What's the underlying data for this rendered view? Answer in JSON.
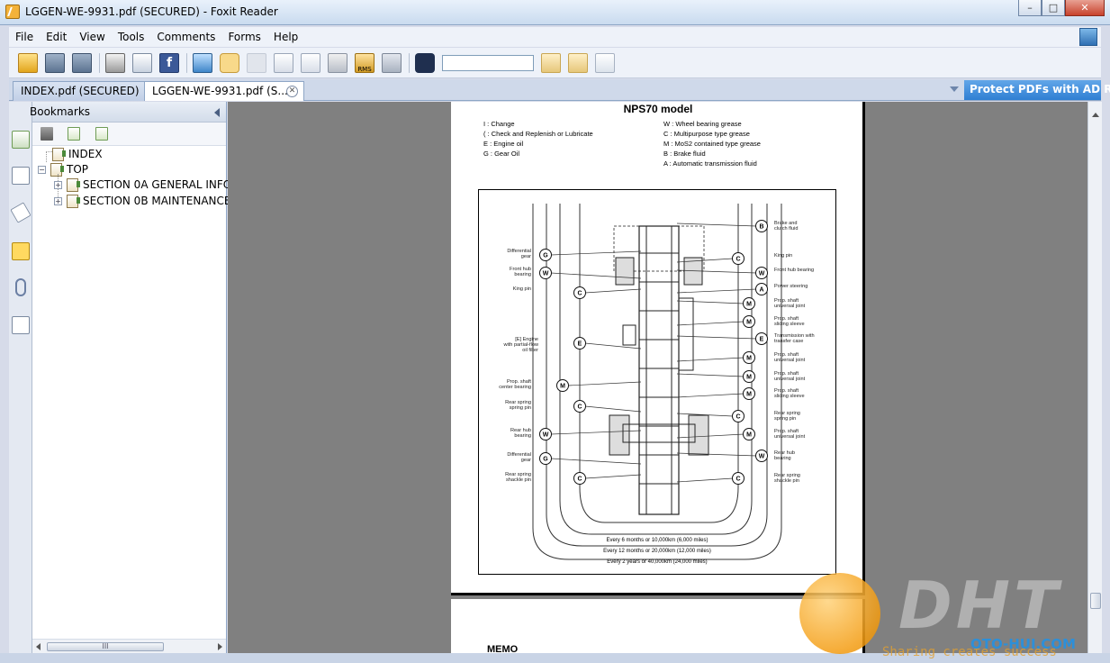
{
  "window": {
    "title": "LGGEN-WE-9931.pdf (SECURED) - Foxit Reader",
    "buttons": {
      "min": "–",
      "max": "□",
      "close": "✕"
    }
  },
  "menu": [
    "File",
    "Edit",
    "View",
    "Tools",
    "Comments",
    "Forms",
    "Help"
  ],
  "toolbar": {
    "icons": [
      "open-icon",
      "save-icon",
      "save-all-icon",
      "print-icon",
      "email-icon",
      "facebook-icon",
      "fullscreen-icon",
      "hand-tool-icon",
      "zoom-tool-icon",
      "select-tool-icon",
      "text-select-icon",
      "snapshot-icon",
      "rms-icon",
      "sign-icon",
      "find-icon",
      "find-prev-icon",
      "find-next-icon",
      "clear-search-icon"
    ],
    "facebook_label": "f",
    "rms_label": "RMS",
    "search_value": ""
  },
  "tabs": [
    {
      "label": "INDEX.pdf (SECURED)"
    },
    {
      "label": "LGGEN-WE-9931.pdf (S..."
    }
  ],
  "protect_label": "Protect PDFs with AD RMS",
  "bookmarks": {
    "header": "Bookmarks",
    "items": [
      {
        "label": "INDEX"
      },
      {
        "label": "TOP"
      },
      {
        "label": "SECTION 0A GENERAL INFOR"
      },
      {
        "label": "SECTION 0B MAINTENANCE A"
      }
    ],
    "scroll_label": "III"
  },
  "document": {
    "title": "NPS70 model",
    "legend_left": [
      "I : Change",
      "( : Check and Replenish or Lubricate",
      "E : Engine oil",
      "G : Gear Oil"
    ],
    "legend_right": [
      "W : Wheel bearing grease",
      "C : Multipurpose type grease",
      "M : MoS2 contained type grease",
      "B : Brake fluid",
      "A : Automatic transmission fluid"
    ],
    "labels_left": [
      "Differential\ngear",
      "Front hub\nbearing",
      "King pin",
      "[E] Engine\nwith partial-flow\noil filter",
      "Prop. shaft\ncenter bearing",
      "Rear spring\nspring pin",
      "Rear hub\nbearing",
      "Differential\ngear",
      "Rear spring\nshackle pin"
    ],
    "labels_right": [
      "Brake and\nclutch fluid",
      "King pin",
      "Front hub bearing",
      "Power steering",
      "Prop. shaft\nuniversal joint",
      "Prop. shaft\nsliding sleeve",
      "Transmission with\ntransfer case",
      "Prop. shaft\nuniversal joint",
      "Prop. shaft\nuniversal joint",
      "Prop. shaft\nsliding sleeve",
      "Rear spring\nspring pin",
      "Prop. shaft\nuniversal joint",
      "Rear hub\nbearing",
      "Rear spring\nshackle pin"
    ],
    "symbols_left": [
      "G",
      "W",
      "C",
      "E",
      "M",
      "C",
      "W",
      "G",
      "C"
    ],
    "symbols_right": [
      "B",
      "C",
      "W",
      "A",
      "M",
      "M",
      "E",
      "M",
      "M",
      "M",
      "C",
      "M",
      "W",
      "C"
    ],
    "intervals": [
      "Every 6 months or 10,000km (6,000 miles)",
      "Every 12 months or 20,000km (12,000 miles)",
      "Every 2 years or 40,000km (24,000 miles)"
    ],
    "page2_text": "MEMO"
  },
  "watermark": {
    "brand": "DHT",
    "site": "OTO-HUI.COM",
    "tagline": "Sharing creates success"
  },
  "colors": {
    "accent": "#2f7fd3",
    "page_bg": "#808080"
  }
}
